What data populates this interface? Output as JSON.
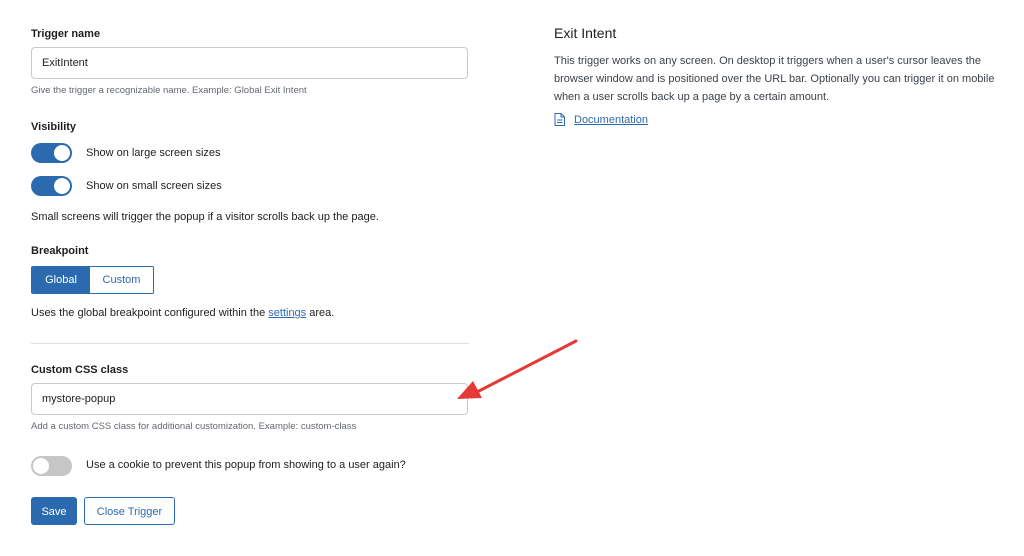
{
  "trigger_name": {
    "label": "Trigger name",
    "value": "ExitIntent",
    "help": "Give the trigger a recognizable name. Example: Global Exit Intent"
  },
  "visibility": {
    "label": "Visibility",
    "large_screen": {
      "label": "Show on large screen sizes",
      "enabled": true
    },
    "small_screen": {
      "label": "Show on small screen sizes",
      "enabled": true
    },
    "note": "Small screens will trigger the popup if a visitor scrolls back up the page."
  },
  "breakpoint": {
    "label": "Breakpoint",
    "options": [
      "Global",
      "Custom"
    ],
    "selected": "Global",
    "note_before": "Uses the global breakpoint configured within the ",
    "note_link": "settings",
    "note_after": " area."
  },
  "custom_css": {
    "label": "Custom CSS class",
    "value": "mystore-popup",
    "help": "Add a custom CSS class for additional customization. Example: custom-class"
  },
  "cookie": {
    "label": "Use a cookie to prevent this popup from showing to a user again?",
    "enabled": false
  },
  "actions": {
    "save_label": "Save",
    "close_label": "Close Trigger"
  },
  "info": {
    "title": "Exit Intent",
    "description": "This trigger works on any screen. On desktop it triggers when a user's cursor leaves the browser window and is positioned over the URL bar. Optionally you can trigger it on mobile when a user scrolls back up a page by a certain amount.",
    "doc_link_label": "Documentation",
    "doc_icon": "document-icon"
  },
  "colors": {
    "accent": "#2c6aaf",
    "toggle_off": "#c6c6c6",
    "annotation_arrow": "#e53935"
  }
}
